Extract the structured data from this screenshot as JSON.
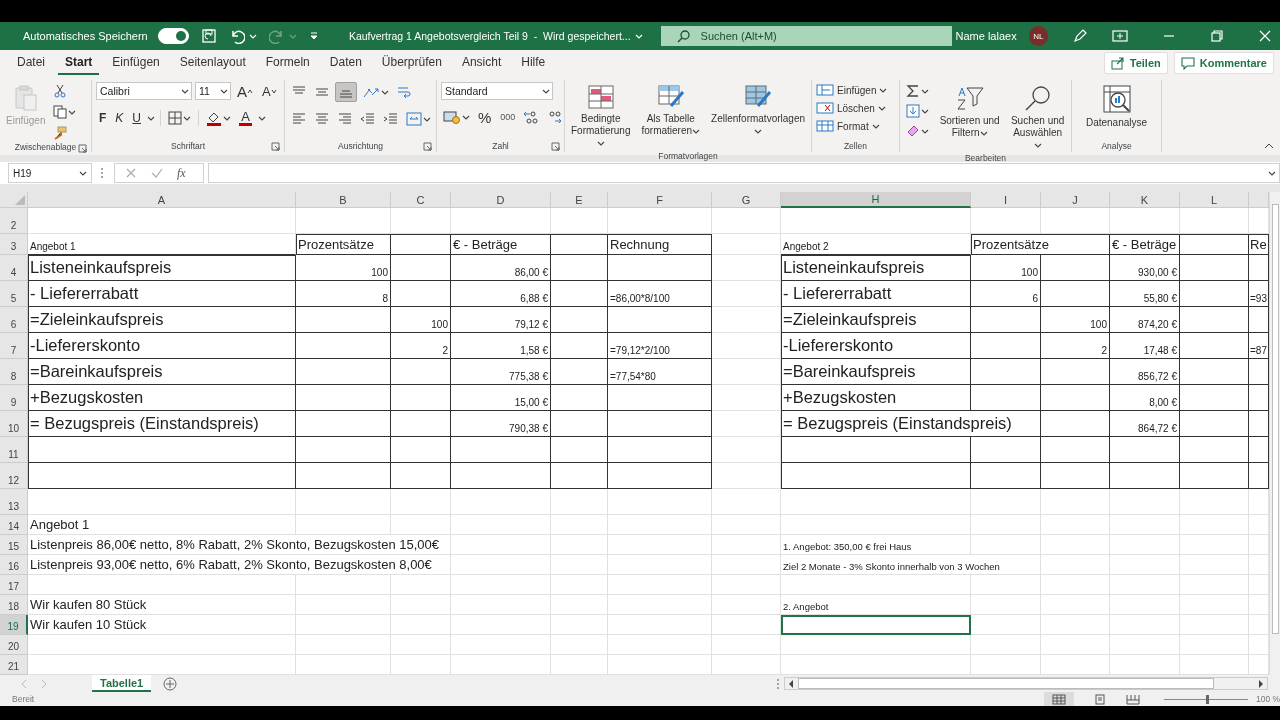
{
  "title_bar": {
    "autosave_label": "Automatisches Speichern",
    "autosave_on": true,
    "document_title": "Kaufvertrag 1 Angebotsvergleich Teil 9  -  Wird gespeichert...",
    "search_placeholder": "Suchen (Alt+M)",
    "user_name": "Name lalaex",
    "avatar_initials": "NL"
  },
  "menu_tabs": [
    {
      "label": "Datei",
      "selected": false
    },
    {
      "label": "Start",
      "selected": true
    },
    {
      "label": "Einfügen",
      "selected": false
    },
    {
      "label": "Seitenlayout",
      "selected": false
    },
    {
      "label": "Formeln",
      "selected": false
    },
    {
      "label": "Daten",
      "selected": false
    },
    {
      "label": "Überprüfen",
      "selected": false
    },
    {
      "label": "Ansicht",
      "selected": false
    },
    {
      "label": "Hilfe",
      "selected": false
    }
  ],
  "share_button": "Teilen",
  "comments_button": "Kommentare",
  "ribbon_groups": [
    {
      "kind": "clipboard",
      "title": "Zwischenablage",
      "paste_label": "Einfügen",
      "paste_disabled": true
    },
    {
      "kind": "font",
      "title": "Schriftart",
      "font": "Calibri",
      "size": "11",
      "grow": "A",
      "shrink": "A",
      "bold": "F",
      "italic": "K",
      "underline": "U",
      "font_color": "A"
    },
    {
      "kind": "alignment",
      "title": "Ausrichtung",
      "bottom_align_on": true
    },
    {
      "kind": "number",
      "title": "Zahl",
      "format": "Standard",
      "percent": "%",
      "thousands": "000"
    },
    {
      "kind": "styles",
      "title": "Formatvorlagen",
      "buttons": [
        "Bedingte Formatierung",
        "Als Tabelle formatieren",
        "Zellenformatvorlagen"
      ]
    },
    {
      "kind": "cells",
      "title": "Zellen",
      "buttons": [
        "Einfügen",
        "Löschen",
        "Format"
      ]
    },
    {
      "kind": "editing",
      "title": "Bearbeiten",
      "buttons": [
        "Sortieren und Filtern",
        "Suchen und Auswählen"
      ]
    },
    {
      "kind": "analysis",
      "title": "Analyse",
      "buttons": [
        "Datenanalyse"
      ]
    }
  ],
  "formula_bar": {
    "name_box": "H19",
    "fx": "fx"
  },
  "sheet": {
    "columns": [
      {
        "label": "A",
        "selected": false
      },
      {
        "label": "B",
        "selected": false
      },
      {
        "label": "C",
        "selected": false
      },
      {
        "label": "D",
        "selected": false
      },
      {
        "label": "E",
        "selected": false
      },
      {
        "label": "F",
        "selected": false
      },
      {
        "label": "G",
        "selected": false
      },
      {
        "label": "H",
        "selected": true
      },
      {
        "label": "I",
        "selected": false
      },
      {
        "label": "J",
        "selected": false
      },
      {
        "label": "K",
        "selected": false
      },
      {
        "label": "L",
        "selected": false
      }
    ],
    "rows": [
      {
        "number": "2",
        "selected": false,
        "cells": [
          null,
          null,
          null,
          null,
          null,
          null,
          null,
          null,
          null,
          null,
          null,
          null,
          null
        ]
      },
      {
        "number": "3",
        "selected": false,
        "cells": [
          {
            "kind": "caption",
            "text": "Angebot 1"
          },
          {
            "kind": "heading",
            "text": "Prozentsätze"
          },
          null,
          {
            "kind": "heading",
            "text": "€ - Beträge"
          },
          null,
          {
            "kind": "heading",
            "text": "Rechnung"
          },
          null,
          {
            "kind": "caption",
            "text": "Angebot 2"
          },
          {
            "kind": "heading",
            "text": "Prozentsätze"
          },
          null,
          {
            "kind": "heading",
            "text": "€ - Beträge"
          },
          null,
          {
            "kind": "heading",
            "text": "Re"
          }
        ]
      },
      {
        "number": "4",
        "selected": false,
        "cells": [
          {
            "kind": "title",
            "text": "Listeneinkaufspreis"
          },
          {
            "kind": "number",
            "text": "100"
          },
          null,
          {
            "kind": "number",
            "text": "86,00 €"
          },
          null,
          null,
          null,
          {
            "kind": "title",
            "text": "Listeneinkaufspreis"
          },
          {
            "kind": "number",
            "text": "100"
          },
          null,
          {
            "kind": "number",
            "text": "930,00 €"
          },
          null,
          null
        ]
      },
      {
        "number": "5",
        "selected": false,
        "cells": [
          {
            "kind": "title",
            "text": "- Liefererrabatt"
          },
          {
            "kind": "number",
            "text": "8"
          },
          null,
          {
            "kind": "number",
            "text": "6,88 €"
          },
          null,
          {
            "kind": "formula",
            "text": "=86,00*8/100"
          },
          null,
          {
            "kind": "title",
            "text": "- Liefererrabatt"
          },
          {
            "kind": "number",
            "text": "6"
          },
          null,
          {
            "kind": "number",
            "text": "55,80 €"
          },
          null,
          {
            "kind": "formula",
            "text": "=93"
          }
        ]
      },
      {
        "number": "6",
        "selected": false,
        "cells": [
          {
            "kind": "title",
            "text": "=Zieleinkaufspreis"
          },
          null,
          {
            "kind": "number",
            "text": "100"
          },
          {
            "kind": "number",
            "text": "79,12 €"
          },
          null,
          null,
          null,
          {
            "kind": "title",
            "text": "=Zieleinkaufspreis"
          },
          null,
          {
            "kind": "number",
            "text": "100"
          },
          {
            "kind": "number",
            "text": "874,20 €"
          },
          null,
          null
        ]
      },
      {
        "number": "7",
        "selected": false,
        "cells": [
          {
            "kind": "title",
            "text": "-Liefererskonto"
          },
          null,
          {
            "kind": "number",
            "text": "2"
          },
          {
            "kind": "number",
            "text": "1,58 €"
          },
          null,
          {
            "kind": "formula",
            "text": "=79,12*2/100"
          },
          null,
          {
            "kind": "title",
            "text": "-Liefererskonto"
          },
          null,
          {
            "kind": "number",
            "text": "2"
          },
          {
            "kind": "number",
            "text": "17,48 €"
          },
          null,
          {
            "kind": "formula",
            "text": "=87"
          }
        ]
      },
      {
        "number": "8",
        "selected": false,
        "cells": [
          {
            "kind": "title",
            "text": "=Bareinkaufspreis"
          },
          null,
          null,
          {
            "kind": "number",
            "text": "775,38 €"
          },
          null,
          {
            "kind": "formula",
            "text": "=77,54*80"
          },
          null,
          {
            "kind": "title",
            "text": "=Bareinkaufspreis"
          },
          null,
          null,
          {
            "kind": "number",
            "text": "856,72 €"
          },
          null,
          null
        ]
      },
      {
        "number": "9",
        "selected": false,
        "cells": [
          {
            "kind": "title",
            "text": "+Bezugskosten"
          },
          null,
          null,
          {
            "kind": "number",
            "text": "15,00 €"
          },
          null,
          null,
          null,
          {
            "kind": "title",
            "text": "+Bezugskosten"
          },
          null,
          null,
          {
            "kind": "number",
            "text": "8,00 €"
          },
          null,
          null
        ]
      },
      {
        "number": "10",
        "selected": false,
        "cells": [
          {
            "kind": "title",
            "text": "= Bezugspreis (Einstandspreis)"
          },
          null,
          null,
          {
            "kind": "number",
            "text": "790,38 €"
          },
          null,
          null,
          null,
          {
            "kind": "title",
            "text": "= Bezugspreis (Einstandspreis)"
          },
          null,
          null,
          {
            "kind": "number",
            "text": "864,72 €"
          },
          null,
          null
        ]
      },
      {
        "number": "11",
        "selected": false,
        "cells": [
          null,
          null,
          null,
          null,
          null,
          null,
          null,
          null,
          null,
          null,
          null,
          null,
          null
        ]
      },
      {
        "number": "12",
        "selected": false,
        "cells": [
          null,
          null,
          null,
          null,
          null,
          null,
          null,
          null,
          null,
          null,
          null,
          null,
          null
        ]
      },
      {
        "number": "13",
        "selected": false,
        "cells": [
          null,
          null,
          null,
          null,
          null,
          null,
          null,
          null,
          null,
          null,
          null,
          null,
          null
        ]
      },
      {
        "number": "14",
        "selected": false,
        "cells": [
          {
            "kind": "text",
            "text": "Angebot 1"
          },
          null,
          null,
          null,
          null,
          null,
          null,
          null,
          null,
          null,
          null,
          null,
          null
        ]
      },
      {
        "number": "15",
        "selected": false,
        "cells": [
          {
            "kind": "text",
            "text": "Listenpreis 86,00€ netto, 8% Rabatt, 2% Skonto, Bezugskosten 15,00€"
          },
          null,
          null,
          null,
          null,
          null,
          null,
          {
            "kind": "small",
            "text": "1. Angebot: 350,00 € frei Haus"
          },
          null,
          null,
          null,
          null,
          null
        ]
      },
      {
        "number": "16",
        "selected": false,
        "cells": [
          {
            "kind": "text",
            "text": "Listenpreis 93,00€ netto, 6% Rabatt, 2% Skonto, Bezugskosten 8,00€"
          },
          null,
          null,
          null,
          null,
          null,
          null,
          {
            "kind": "small",
            "text": "Ziel 2 Monate - 3% Skonto innerhalb von 3 Wochen"
          },
          null,
          null,
          null,
          null,
          null
        ]
      },
      {
        "number": "17",
        "selected": false,
        "cells": [
          null,
          null,
          null,
          null,
          null,
          null,
          null,
          null,
          null,
          null,
          null,
          null,
          null
        ]
      },
      {
        "number": "18",
        "selected": false,
        "cells": [
          {
            "kind": "text",
            "text": "Wir kaufen 80 Stück"
          },
          null,
          null,
          null,
          null,
          null,
          null,
          {
            "kind": "small",
            "text": "2. Angebot"
          },
          null,
          null,
          null,
          null,
          null
        ]
      },
      {
        "number": "19",
        "selected": true,
        "cells": [
          {
            "kind": "text",
            "text": "Wir kaufen 10 Stück"
          },
          null,
          null,
          null,
          null,
          null,
          null,
          null,
          null,
          null,
          null,
          null,
          null
        ]
      },
      {
        "number": "20",
        "selected": false,
        "cells": [
          null,
          null,
          null,
          null,
          null,
          null,
          null,
          null,
          null,
          null,
          null,
          null,
          null
        ]
      },
      {
        "number": "21",
        "selected": false,
        "cells": [
          null,
          null,
          null,
          null,
          null,
          null,
          null,
          null,
          null,
          null,
          null,
          null,
          null
        ]
      }
    ]
  },
  "sheet_tabs": [
    {
      "label": "Tabelle1",
      "selected": true
    }
  ],
  "status_bar": {
    "status": "Bereit",
    "zoom_slider": {
      "level": 0.5
    },
    "zoom": "100 %"
  }
}
